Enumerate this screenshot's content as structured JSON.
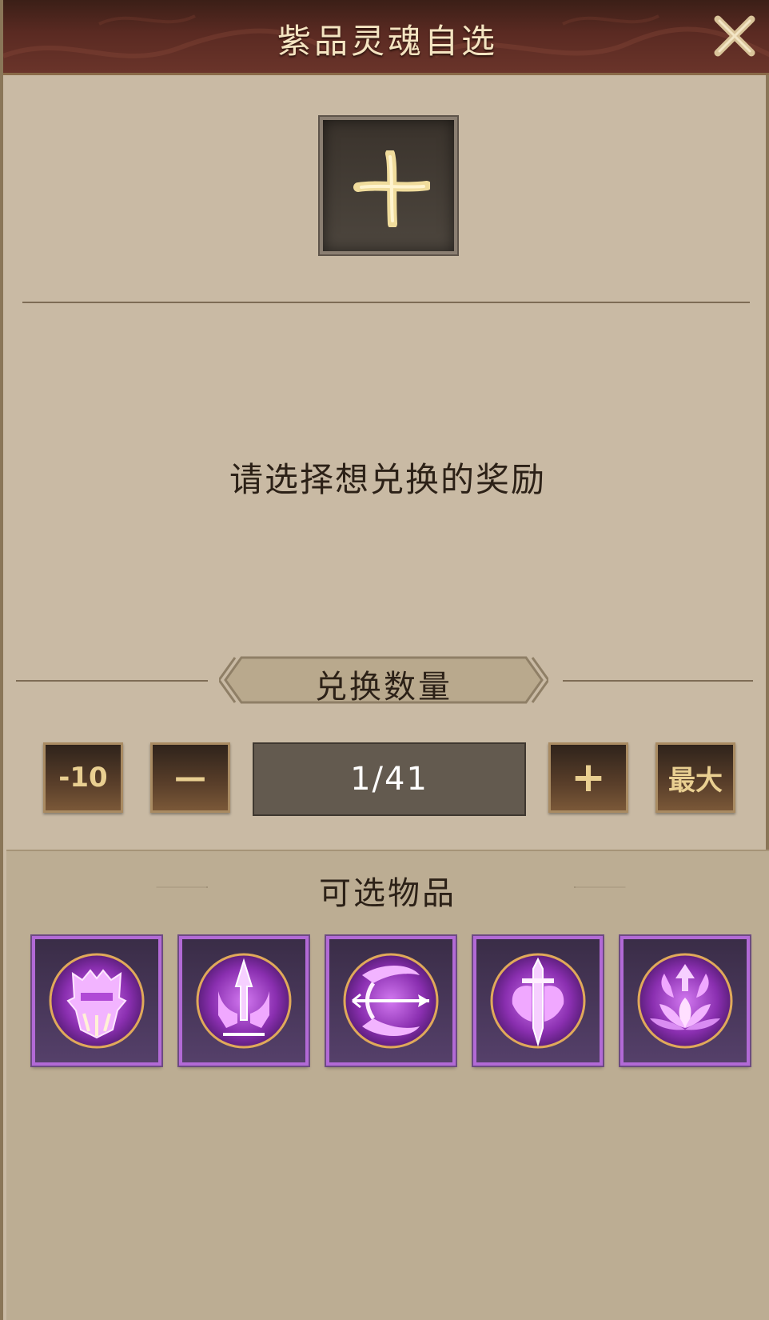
{
  "title": "紫品灵魂自选",
  "close_icon": "close-x-icon",
  "reward_slot": {
    "icon": "plus-icon"
  },
  "prompt": "请选择想兑换的奖励",
  "quantity": {
    "label": "兑换数量",
    "minus10_label": "-10",
    "minus_label": "—",
    "value": "1/41",
    "plus_label": "+",
    "max_label": "最大"
  },
  "items_section": {
    "title": "可选物品",
    "items": [
      {
        "icon": "mask-soul-icon",
        "rarity": "purple"
      },
      {
        "icon": "trident-crown-soul-icon",
        "rarity": "purple"
      },
      {
        "icon": "bow-arrow-soul-icon",
        "rarity": "purple"
      },
      {
        "icon": "sword-wings-soul-icon",
        "rarity": "purple"
      },
      {
        "icon": "lotus-soul-icon",
        "rarity": "purple"
      }
    ]
  },
  "colors": {
    "purple_frame": "#b26ad6",
    "gold_text": "#e9cf91",
    "panel_bg": "#c9baa4"
  }
}
